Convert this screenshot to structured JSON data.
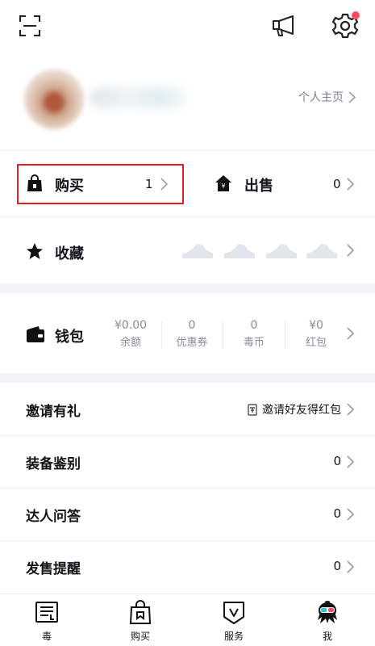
{
  "header": {
    "scan_icon": "scan-icon",
    "message_icon": "megaphone-icon",
    "settings_icon": "gear-icon",
    "notification_dot_color": "#ff4d5e"
  },
  "profile": {
    "homepage_label": "个人主页"
  },
  "orders": {
    "buy_label": "购买",
    "buy_count": "1",
    "sell_label": "出售",
    "sell_count": "0",
    "highlight_color": "#e02020"
  },
  "favorites": {
    "label": "收藏"
  },
  "wallet": {
    "label": "钱包",
    "items": [
      {
        "value": "¥0.00",
        "name": "余额"
      },
      {
        "value": "0",
        "name": "优惠券"
      },
      {
        "value": "0",
        "name": "毒币"
      },
      {
        "value": "¥0",
        "name": "红包"
      }
    ]
  },
  "menu": [
    {
      "label": "邀请有礼",
      "value": "邀请好友得红包"
    },
    {
      "label": "装备鉴别",
      "value": "0"
    },
    {
      "label": "达人问答",
      "value": "0"
    },
    {
      "label": "发售提醒",
      "value": "0"
    }
  ],
  "tabbar": {
    "tabs": [
      {
        "label": "毒",
        "icon": "newspaper-icon"
      },
      {
        "label": "购买",
        "icon": "shopping-bag-icon"
      },
      {
        "label": "服务",
        "icon": "shield-v-icon"
      },
      {
        "label": "我",
        "icon": "avatar-mascot-icon",
        "active": true
      }
    ]
  }
}
